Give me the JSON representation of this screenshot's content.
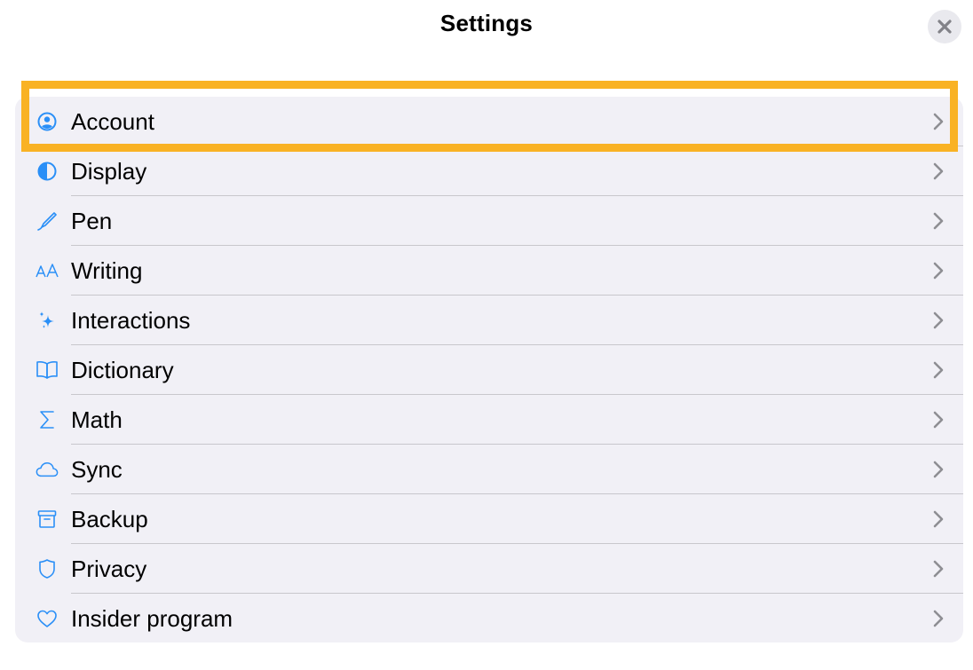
{
  "header": {
    "title": "Settings",
    "close_icon": "close-icon"
  },
  "accent_color": "#2a8ff7",
  "highlight_color": "#f9b224",
  "settings": {
    "items": [
      {
        "label": "Account",
        "icon": "account-icon"
      },
      {
        "label": "Display",
        "icon": "display-icon"
      },
      {
        "label": "Pen",
        "icon": "pen-icon"
      },
      {
        "label": "Writing",
        "icon": "writing-icon"
      },
      {
        "label": "Interactions",
        "icon": "sparkles-icon"
      },
      {
        "label": "Dictionary",
        "icon": "book-icon"
      },
      {
        "label": "Math",
        "icon": "sigma-icon"
      },
      {
        "label": "Sync",
        "icon": "cloud-icon"
      },
      {
        "label": "Backup",
        "icon": "archive-box-icon"
      },
      {
        "label": "Privacy",
        "icon": "shield-icon"
      },
      {
        "label": "Insider program",
        "icon": "heart-icon"
      }
    ]
  }
}
